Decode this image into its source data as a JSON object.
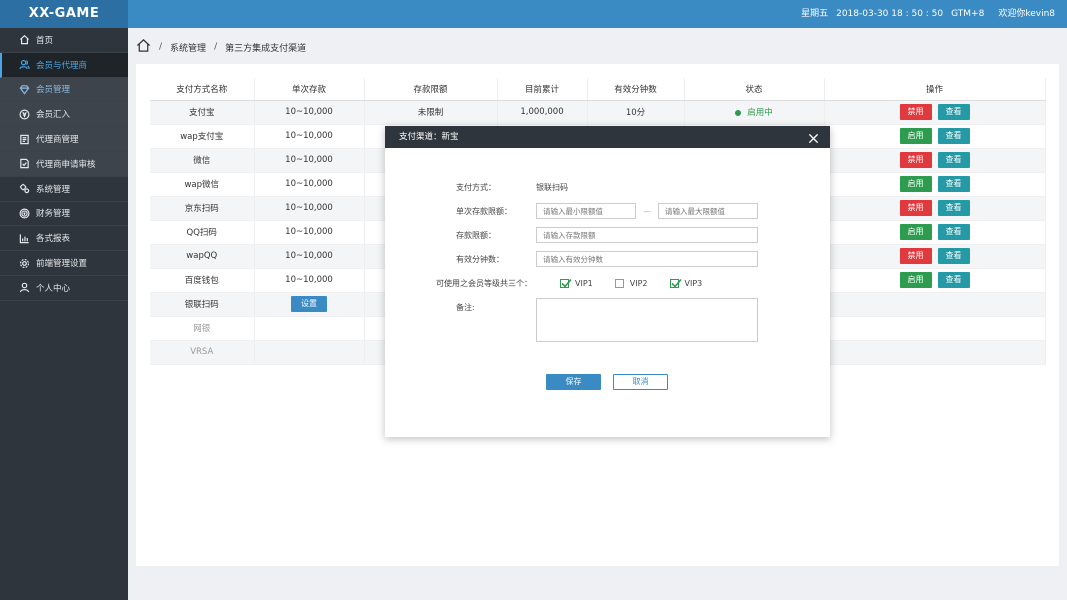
{
  "header": {
    "logo": "XX-GAME",
    "weekday": "星期五",
    "datetime": "2018-03-30 18 : 50 : 50",
    "timezone": "GTM+8",
    "welcome": "欢迎你kevin8"
  },
  "sidebar": {
    "items": [
      {
        "label": "首页",
        "icon": "home-icon"
      },
      {
        "label": "会员与代理商",
        "icon": "users-icon"
      },
      {
        "label": "会员管理",
        "icon": "diamond-icon"
      },
      {
        "label": "会员汇入",
        "icon": "currency-icon"
      },
      {
        "label": "代理商管理",
        "icon": "list-icon"
      },
      {
        "label": "代理商申请审核",
        "icon": "doc-check-icon"
      },
      {
        "label": "系统管理",
        "icon": "gears-icon"
      },
      {
        "label": "财务管理",
        "icon": "coin-icon"
      },
      {
        "label": "各式报表",
        "icon": "chart-icon"
      },
      {
        "label": "前端管理设置",
        "icon": "gear-icon"
      },
      {
        "label": "个人中心",
        "icon": "person-icon"
      }
    ]
  },
  "breadcrumb": {
    "sep": "/",
    "level1": "系统管理",
    "level2": "第三方集成支付渠道"
  },
  "table": {
    "headers": [
      "支付方式名称",
      "单次存款",
      "存款限额",
      "目前累计",
      "有效分钟数",
      "状态",
      "操作"
    ],
    "rows": [
      {
        "name": "支付宝",
        "single": "10~10,000",
        "limit": "未限制",
        "total": "1,000,000",
        "minutes": "10分",
        "status": "启用中",
        "toggle": "禁用",
        "toggle_color": "red",
        "view": "查看"
      },
      {
        "name": "wap支付宝",
        "single": "10~10,000",
        "toggle": "启用",
        "toggle_color": "green",
        "view": "查看"
      },
      {
        "name": "微信",
        "single": "10~10,000",
        "toggle": "禁用",
        "toggle_color": "red",
        "view": "查看"
      },
      {
        "name": "wap微信",
        "single": "10~10,000",
        "toggle": "启用",
        "toggle_color": "green",
        "view": "查看"
      },
      {
        "name": "京东扫码",
        "single": "10~10,000",
        "toggle": "禁用",
        "toggle_color": "red",
        "view": "查看"
      },
      {
        "name": "QQ扫码",
        "single": "10~10,000",
        "toggle": "启用",
        "toggle_color": "green",
        "view": "查看"
      },
      {
        "name": "wapQQ",
        "single": "10~10,000",
        "toggle": "禁用",
        "toggle_color": "red",
        "view": "查看"
      },
      {
        "name": "百度钱包",
        "single": "10~10,000",
        "toggle": "启用",
        "toggle_color": "green",
        "view": "查看"
      },
      {
        "name": "银联扫码",
        "setup": "设置"
      },
      {
        "name": "网银"
      },
      {
        "name": "VRSA"
      }
    ]
  },
  "modal": {
    "title": "支付渠道：新宝",
    "method_label": "支付方式：",
    "method_value": "银联扫码",
    "single_label": "单次存款限额：",
    "min_placeholder": "请输入最小限额值",
    "range_sep": "—",
    "max_placeholder": "请输入最大限额值",
    "limit_label": "存款限额：",
    "limit_placeholder": "请输入存款限额",
    "minutes_label": "有效分钟数：",
    "minutes_placeholder": "请输入有效分钟数",
    "vip_label": "可使用之会员等级共三个：",
    "vips": [
      {
        "label": "VIP1",
        "checked": true
      },
      {
        "label": "VIP2",
        "checked": false
      },
      {
        "label": "VIP3",
        "checked": true
      }
    ],
    "remark_label": "备注:",
    "save": "保存",
    "cancel": "取消"
  },
  "colors": {
    "topbar": "#3a8ac4",
    "sidebar": "#2f353c",
    "red": "#e0393e",
    "green": "#2e9c4e",
    "teal": "#249aa6"
  }
}
